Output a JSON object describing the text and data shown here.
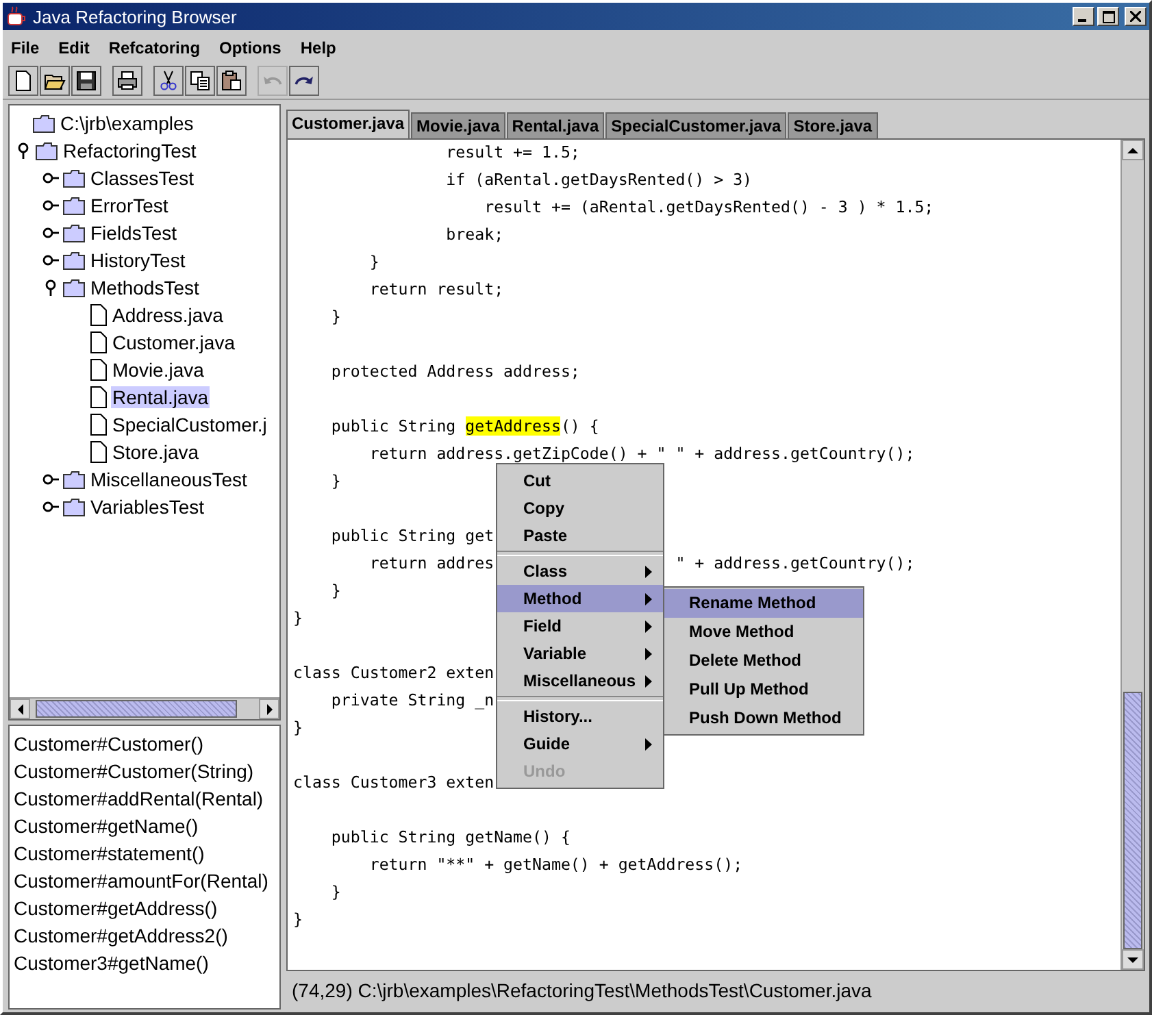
{
  "window": {
    "title": "Java Refactoring Browser"
  },
  "menubar": [
    {
      "label": "File"
    },
    {
      "label": "Edit"
    },
    {
      "label": "Refcatoring"
    },
    {
      "label": "Options"
    },
    {
      "label": "Help"
    }
  ],
  "toolbar": [
    [
      {
        "kind": "new",
        "disabled": false
      },
      {
        "kind": "open",
        "disabled": false
      },
      {
        "kind": "save",
        "disabled": false
      }
    ],
    [
      {
        "kind": "print",
        "disabled": false
      }
    ],
    [
      {
        "kind": "cut",
        "disabled": false
      },
      {
        "kind": "copy",
        "disabled": false
      },
      {
        "kind": "paste",
        "disabled": false
      }
    ],
    [
      {
        "kind": "undo",
        "disabled": true
      },
      {
        "kind": "redo",
        "disabled": false
      }
    ]
  ],
  "tree": {
    "label": "C:\\jrb\\examples",
    "kind": "folder",
    "selected": false,
    "children": [
      {
        "label": "RefactoringTest",
        "kind": "folder",
        "expanded": true,
        "selected": false,
        "children": [
          {
            "label": "ClassesTest",
            "kind": "folder",
            "expanded": false,
            "selected": false
          },
          {
            "label": "ErrorTest",
            "kind": "folder",
            "expanded": false,
            "selected": false
          },
          {
            "label": "FieldsTest",
            "kind": "folder",
            "expanded": false,
            "selected": false
          },
          {
            "label": "HistoryTest",
            "kind": "folder",
            "expanded": false,
            "selected": false
          },
          {
            "label": "MethodsTest",
            "kind": "folder",
            "expanded": true,
            "selected": false,
            "children": [
              {
                "label": "Address.java",
                "kind": "file",
                "selected": false
              },
              {
                "label": "Customer.java",
                "kind": "file",
                "selected": false
              },
              {
                "label": "Movie.java",
                "kind": "file",
                "selected": false
              },
              {
                "label": "Rental.java",
                "kind": "file",
                "selected": true
              },
              {
                "label": "SpecialCustomer.j",
                "kind": "file",
                "selected": false
              },
              {
                "label": "Store.java",
                "kind": "file",
                "selected": false
              }
            ]
          },
          {
            "label": "MiscellaneousTest",
            "kind": "folder",
            "expanded": false,
            "selected": false
          },
          {
            "label": "VariablesTest",
            "kind": "folder",
            "expanded": false,
            "selected": false
          }
        ]
      }
    ]
  },
  "methods": [
    "Customer#Customer()",
    "Customer#Customer(String)",
    "Customer#addRental(Rental)",
    "Customer#getName()",
    "Customer#statement()",
    "Customer#amountFor(Rental)",
    "Customer#getAddress()",
    "Customer#getAddress2()",
    "Customer3#getName()"
  ],
  "tabs": [
    {
      "label": "Customer.java",
      "selected": true
    },
    {
      "label": "Movie.java",
      "selected": false
    },
    {
      "label": "Rental.java",
      "selected": false
    },
    {
      "label": "SpecialCustomer.java",
      "selected": false
    },
    {
      "label": "Store.java",
      "selected": false
    }
  ],
  "code": [
    {
      "kind": "code",
      "text": "                result += 1.5;"
    },
    {
      "kind": "code",
      "text": "                if (aRental.getDaysRented() > 3)"
    },
    {
      "kind": "code",
      "text": "                    result += (aRental.getDaysRented() - 3 ) * 1.5;"
    },
    {
      "kind": "code",
      "text": "                break;"
    },
    {
      "kind": "code",
      "text": "        }"
    },
    {
      "kind": "code",
      "text": "        return result;"
    },
    {
      "kind": "code",
      "text": "    }"
    },
    {
      "kind": "blank"
    },
    {
      "kind": "code",
      "text": "    protected Address address;"
    },
    {
      "kind": "blank"
    },
    {
      "kind": "marked",
      "segments": [
        {
          "text": "    public String ",
          "highlighted": false
        },
        {
          "text": "getAddress",
          "highlighted": true
        },
        {
          "text": "() {",
          "highlighted": false
        }
      ]
    },
    {
      "kind": "code",
      "text": "        return address.getZipCode() + \" \" + address.getCountry();"
    },
    {
      "kind": "code",
      "text": "    }"
    },
    {
      "kind": "blank"
    },
    {
      "kind": "code",
      "text": "    public String get"
    },
    {
      "kind": "split",
      "parts": [
        "        return addres",
        "\" + address.getCountry();"
      ]
    },
    {
      "kind": "code",
      "text": "    }"
    },
    {
      "kind": "code",
      "text": "}"
    },
    {
      "kind": "blank"
    },
    {
      "kind": "code",
      "text": "class Customer2 exten"
    },
    {
      "kind": "code",
      "text": "    private String _n"
    },
    {
      "kind": "code",
      "text": "}"
    },
    {
      "kind": "blank"
    },
    {
      "kind": "code",
      "text": "class Customer3 exten"
    },
    {
      "kind": "blank"
    },
    {
      "kind": "code",
      "text": "    public String getName() {"
    },
    {
      "kind": "code",
      "text": "        return \"**\" + getName() + getAddress();"
    },
    {
      "kind": "code",
      "text": "    }"
    },
    {
      "kind": "code",
      "text": "}"
    }
  ],
  "context_menu": {
    "groups": [
      [
        {
          "label": "Cut",
          "submenu": false,
          "selected": false,
          "disabled": false
        },
        {
          "label": "Copy",
          "submenu": false,
          "selected": false,
          "disabled": false
        },
        {
          "label": "Paste",
          "submenu": false,
          "selected": false,
          "disabled": false
        }
      ],
      [
        {
          "label": "Class",
          "submenu": true,
          "selected": false,
          "disabled": false
        },
        {
          "label": "Method",
          "submenu": true,
          "selected": true,
          "disabled": false
        },
        {
          "label": "Field",
          "submenu": true,
          "selected": false,
          "disabled": false
        },
        {
          "label": "Variable",
          "submenu": true,
          "selected": false,
          "disabled": false
        },
        {
          "label": "Miscellaneous",
          "submenu": true,
          "selected": false,
          "disabled": false
        }
      ],
      [
        {
          "label": "History...",
          "submenu": false,
          "selected": false,
          "disabled": false
        },
        {
          "label": "Guide",
          "submenu": true,
          "selected": false,
          "disabled": false
        },
        {
          "label": "Undo",
          "submenu": false,
          "selected": false,
          "disabled": true
        }
      ]
    ],
    "submenu": [
      {
        "label": "Rename Method",
        "selected": true
      },
      {
        "label": "Move Method",
        "selected": false
      },
      {
        "label": "Delete Method",
        "selected": false
      },
      {
        "label": "Pull Up Method",
        "selected": false
      },
      {
        "label": "Push Down Method",
        "selected": false
      }
    ]
  },
  "status_bar": "(74,29) C:\\jrb\\examples\\RefactoringTest\\MethodsTest\\Customer.java"
}
